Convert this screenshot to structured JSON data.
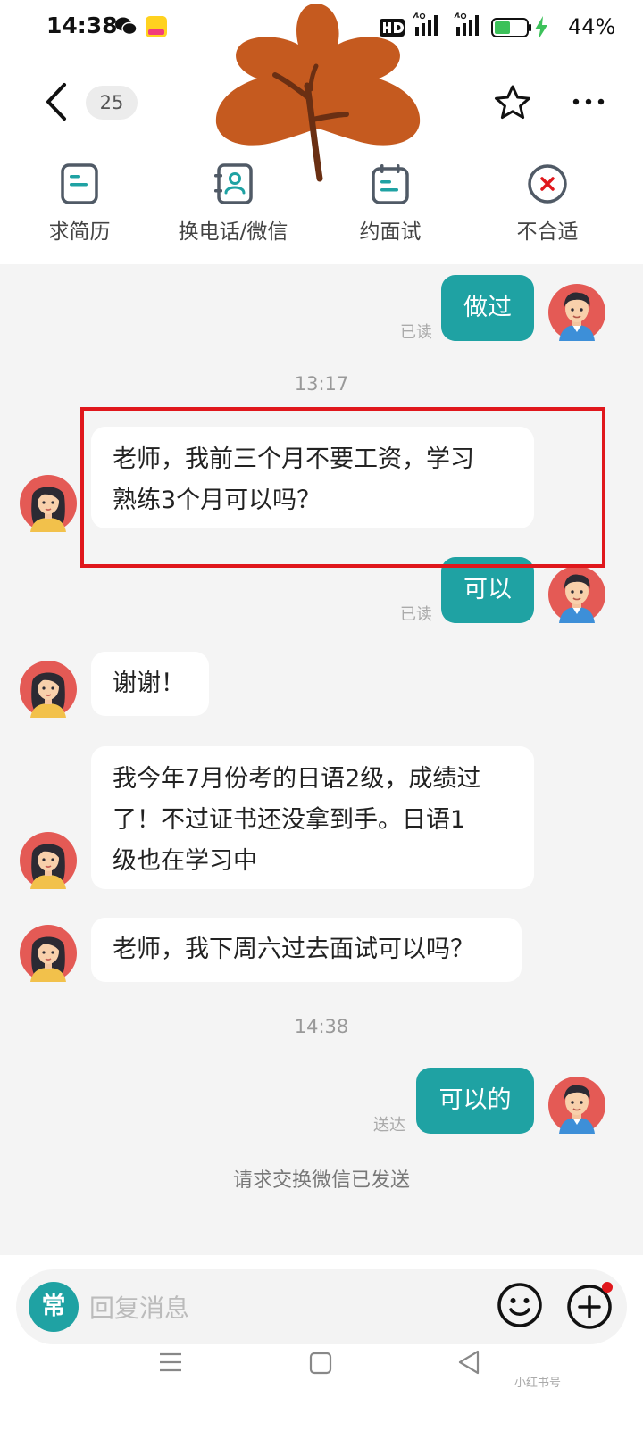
{
  "status_bar": {
    "time": "14:38",
    "battery_percent": "44%",
    "icons": [
      "wechat-icon",
      "meituan-app-icon",
      "hd-icon",
      "signal-4g-icon",
      "signal-4g-icon",
      "battery-icon",
      "charging-icon"
    ]
  },
  "header": {
    "unread_count": "25",
    "icons": [
      "back-arrow-icon",
      "star-icon",
      "more-icon"
    ]
  },
  "actions": [
    {
      "label": "求简历",
      "icon": "resume-icon"
    },
    {
      "label": "换电话/微信",
      "icon": "contact-exchange-icon"
    },
    {
      "label": "约面试",
      "icon": "calendar-icon"
    },
    {
      "label": "不合适",
      "icon": "reject-icon"
    }
  ],
  "messages": {
    "m1": {
      "text": "做过",
      "status": "已读"
    },
    "ts1": "13:17",
    "m2": {
      "line1": "老师，我前三个月不要工资，学习",
      "line2": "熟练3个月可以吗？"
    },
    "m3": {
      "text": "可以",
      "status": "已读"
    },
    "m4": {
      "text": "谢谢！"
    },
    "m5": {
      "line1": "我今年7月份考的日语2级，成绩过",
      "line2": "了！不过证书还没拿到手。日语1",
      "line3": "级也在学习中"
    },
    "m6": {
      "text": "老师，我下周六过去面试可以吗？"
    },
    "ts2": "14:38",
    "m7": {
      "text": "可以的",
      "status": "送达"
    },
    "notice": "请求交换微信已发送"
  },
  "input_bar": {
    "quick_label": "常",
    "placeholder": "回复消息"
  },
  "watermark": "小红书号",
  "colors": {
    "accent": "#1fa2a3",
    "highlight_border": "#e0171c",
    "notification_dot": "#e0171c"
  }
}
